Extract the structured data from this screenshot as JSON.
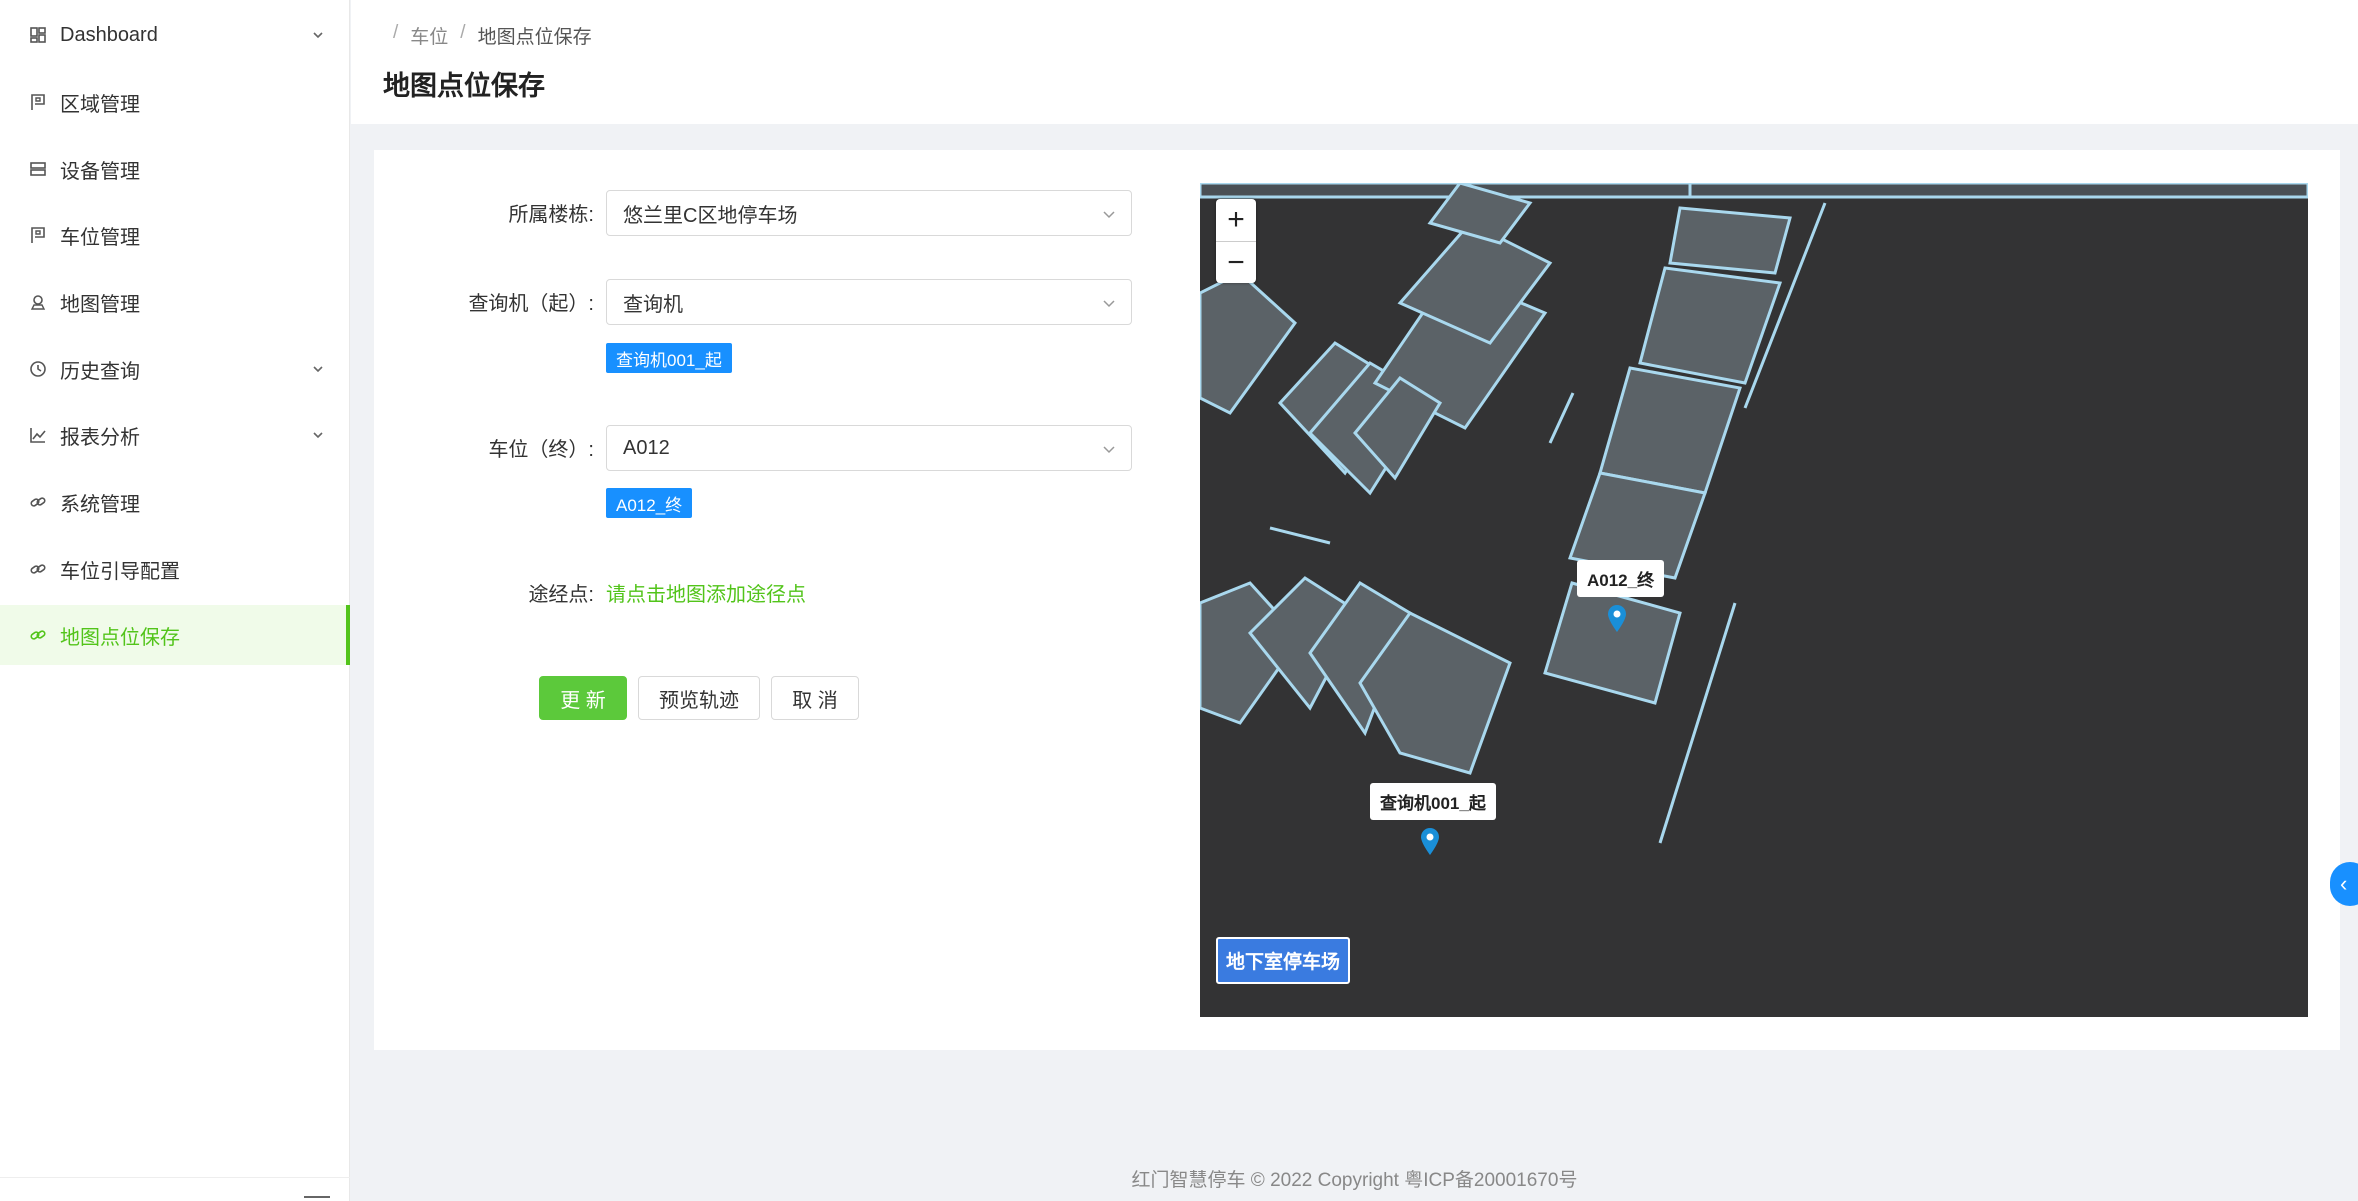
{
  "sidebar": {
    "items": [
      {
        "label": "Dashboard",
        "icon": "dashboard-icon",
        "has_arrow": true
      },
      {
        "label": "区域管理",
        "icon": "parking-sign-icon",
        "has_arrow": false
      },
      {
        "label": "设备管理",
        "icon": "server-icon",
        "has_arrow": false
      },
      {
        "label": "车位管理",
        "icon": "parking-sign-icon",
        "has_arrow": false
      },
      {
        "label": "地图管理",
        "icon": "map-pin-icon",
        "has_arrow": false
      },
      {
        "label": "历史查询",
        "icon": "clock-icon",
        "has_arrow": true
      },
      {
        "label": "报表分析",
        "icon": "line-chart-icon",
        "has_arrow": true
      },
      {
        "label": "系统管理",
        "icon": "link-icon",
        "has_arrow": false
      },
      {
        "label": "车位引导配置",
        "icon": "link-icon",
        "has_arrow": false
      },
      {
        "label": "地图点位保存",
        "icon": "link-icon",
        "has_arrow": false,
        "active": true
      }
    ]
  },
  "breadcrumb": {
    "sep": "/",
    "parent": "车位",
    "current": "地图点位保存"
  },
  "page_title": "地图点位保存",
  "form": {
    "building_label": "所属楼栋:",
    "building_value": "悠兰里C区地停车场",
    "start_label": "查询机（起）:",
    "start_value": "查询机",
    "start_tag": "查询机001_起",
    "end_label": "车位（终）:",
    "end_value": "A012",
    "end_tag": "A012_终",
    "waypoint_label": "途经点:",
    "waypoint_hint": "请点击地图添加途径点"
  },
  "buttons": {
    "update": "更 新",
    "preview": "预览轨迹",
    "cancel": "取 消"
  },
  "map": {
    "zoom_in": "+",
    "zoom_out": "−",
    "marker_end_label": "A012_终",
    "marker_start_label": "查询机001_起",
    "floor_label": "地下室停车场",
    "background": "#333334",
    "line_color": "#a9d8ee",
    "marker_color": "#1a8fd8"
  },
  "side_toggle": "‹",
  "footer": "红门智慧停车 © 2022 Copyright 粤ICP备20001670号",
  "colors": {
    "accent": "#52c41a",
    "primary_button": "#5cc93b",
    "tag": "#1890ff"
  }
}
